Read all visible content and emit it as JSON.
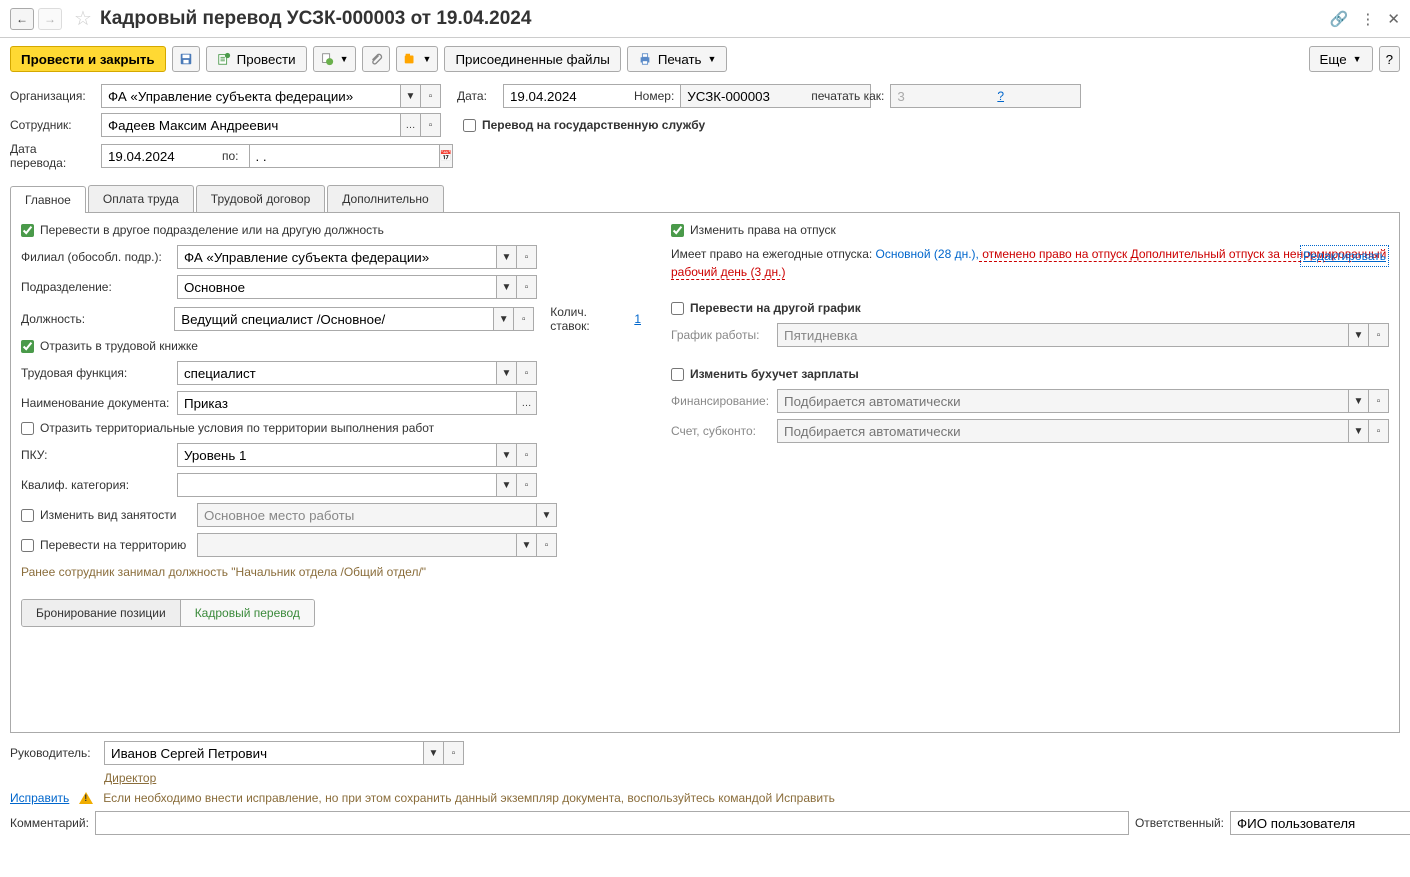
{
  "title": "Кадровый перевод УСЗК-000003 от 19.04.2024",
  "toolbar": {
    "post_close": "Провести и закрыть",
    "post": "Провести",
    "attached": "Присоединенные файлы",
    "print": "Печать",
    "more": "Еще"
  },
  "header": {
    "org_label": "Организация:",
    "org_value": "ФА «Управление субъекта федерации»",
    "date_label": "Дата:",
    "date_value": "19.04.2024",
    "number_label": "Номер:",
    "number_value": "УСЗК-000003",
    "print_as_label": "печатать как:",
    "print_as_value": "3",
    "employee_label": "Сотрудник:",
    "employee_value": "Фадеев Максим Андреевич",
    "gov_service_label": "Перевод на государственную службу",
    "transfer_date_label": "Дата перевода:",
    "transfer_date_value": "19.04.2024",
    "to_label": "по:",
    "to_value": ". ."
  },
  "tabs": [
    "Главное",
    "Оплата труда",
    "Трудовой договор",
    "Дополнительно"
  ],
  "main": {
    "transfer_check": "Перевести в другое подразделение или на другую должность",
    "branch_label": "Филиал (обособл. подр.):",
    "branch_value": "ФА «Управление субъекта федерации»",
    "dept_label": "Подразделение:",
    "dept_value": "Основное",
    "position_label": "Должность:",
    "position_value": "Ведущий специалист /Основное/",
    "stakes_label": "Колич. ставок:",
    "stakes_value": "1",
    "reflect_workbook": "Отразить в трудовой книжке",
    "labor_func_label": "Трудовая функция:",
    "labor_func_value": "специалист",
    "doc_name_label": "Наименование документа:",
    "doc_name_value": "Приказ",
    "reflect_territory": "Отразить территориальные условия по территории выполнения работ",
    "pku_label": "ПКУ:",
    "pku_value": "Уровень 1",
    "qualif_label": "Квалиф. категория:",
    "change_employment": "Изменить вид занятости",
    "employment_value": "Основное место работы",
    "transfer_territory": "Перевести на территорию",
    "previous_position": "Ранее сотрудник занимал должность \"Начальник отдела /Общий отдел/\"",
    "booking": "Бронирование позиции",
    "hr_transfer": "Кадровый перевод"
  },
  "right": {
    "change_vacation": "Изменить права на отпуск",
    "vacation_intro": "Имеет право на ежегодные отпуска: ",
    "vacation_main": "Основной (28 дн.),",
    "vacation_cancel": " отменено право на отпуск Дополнительный отпуск за ненормированный рабочий день (3 дн.)",
    "edit": "Редактировать",
    "transfer_schedule": "Перевести на другой график",
    "schedule_label": "График работы:",
    "schedule_value": "Пятидневка",
    "change_accounting": "Изменить бухучет зарплаты",
    "financing_label": "Финансирование:",
    "financing_placeholder": "Подбирается автоматически",
    "account_label": "Счет, субконто:",
    "account_placeholder": "Подбирается автоматически"
  },
  "bottom": {
    "manager_label": "Руководитель:",
    "manager_value": "Иванов Сергей Петрович",
    "manager_position": "Директор",
    "correct_link": "Исправить",
    "correct_text": "Если необходимо внести исправление, но при этом сохранить данный экземпляр документа, воспользуйтесь командой Исправить",
    "comment_label": "Комментарий:",
    "responsible_label": "Ответственный:",
    "responsible_value": "ФИО пользователя"
  }
}
